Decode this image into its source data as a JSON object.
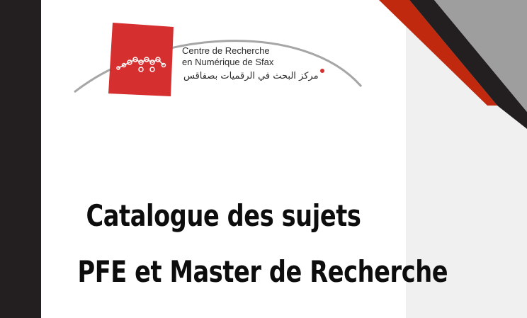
{
  "logo": {
    "line1": "Centre de Recherche",
    "line2": "en Numérique de Sfax",
    "arabic": "مركز البحث في الرقميات بصفاقس",
    "icon": "crns-logo-icon"
  },
  "title": {
    "line1": "Catalogue des sujets",
    "line2": "PFE et Master de Recherche"
  },
  "colors": {
    "accent_red": "#d62f2f",
    "stripe_red": "#c0290e",
    "dark": "#231f20",
    "grey": "#9e9e9e",
    "light_panel": "#f0f0f0"
  }
}
